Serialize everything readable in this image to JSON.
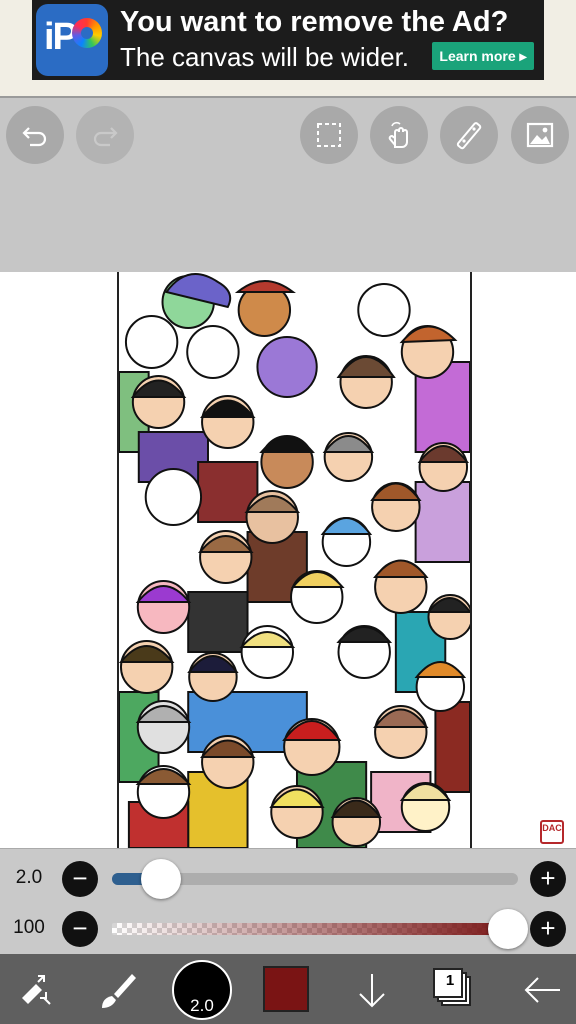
{
  "ad": {
    "title": "You want to remove the Ad?",
    "subtitle": "The canvas will be wider.",
    "cta": "Learn more ▸",
    "logo_text": "iP"
  },
  "toolbar": {
    "buttons": [
      "undo-icon",
      "redo-icon",
      "selection-icon",
      "touch-hand-icon",
      "ruler-icon",
      "image-icon"
    ]
  },
  "stamp": {
    "text": "DAC"
  },
  "sliders": {
    "size": {
      "label": "2.0",
      "level": 0.09,
      "fill_color": "#2e5f8f"
    },
    "opacity": {
      "label": "100",
      "level": 1.0,
      "color": "#7a1414"
    }
  },
  "bottom": {
    "brush_size_label": "2.0",
    "current_color": "#7a1414",
    "layer_count": "1",
    "icons": [
      "transform-icon",
      "brush-icon",
      "brush-size-indicator",
      "color-swatch",
      "download-arrow-icon",
      "layers-icon",
      "back-arrow-icon"
    ]
  }
}
